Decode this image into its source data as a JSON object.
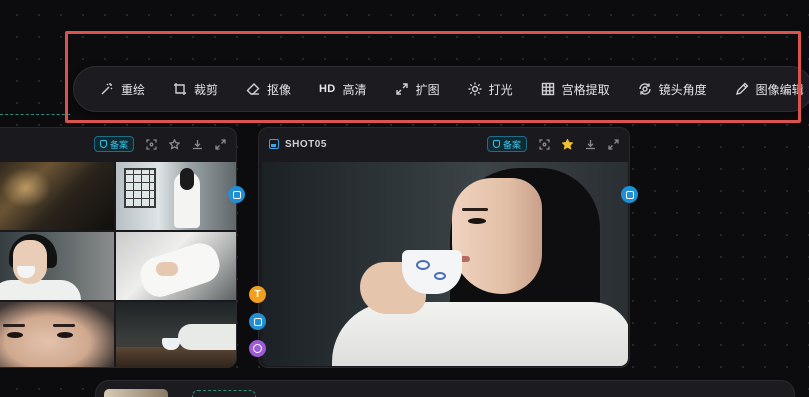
{
  "toolbar": {
    "tools": [
      {
        "label": "重绘",
        "icon": "magic-wand-icon"
      },
      {
        "label": "裁剪",
        "icon": "crop-icon"
      },
      {
        "label": "抠像",
        "icon": "eraser-icon"
      },
      {
        "label": "高清",
        "prefix": "HD",
        "icon": "hd-icon"
      },
      {
        "label": "扩图",
        "icon": "expand-icon"
      },
      {
        "label": "打光",
        "icon": "sun-icon"
      },
      {
        "label": "宫格提取",
        "icon": "grid-icon"
      },
      {
        "label": "镜头角度",
        "icon": "camera-rotate-icon"
      },
      {
        "label": "图像编辑",
        "icon": "pencil-icon"
      }
    ],
    "highlight_color": "#d9534f"
  },
  "cards": {
    "left": {
      "badge": "备案"
    },
    "right": {
      "title": "SHOT05",
      "badge": "备案"
    }
  },
  "side_dots": {
    "text_label": "T"
  },
  "colors": {
    "accent_blue": "#1f8fd6",
    "accent_orange": "#f0a01e",
    "accent_purple": "#9b5cd6",
    "badge_cyan": "#3ac2e6",
    "star_yellow": "#f2c22e"
  }
}
